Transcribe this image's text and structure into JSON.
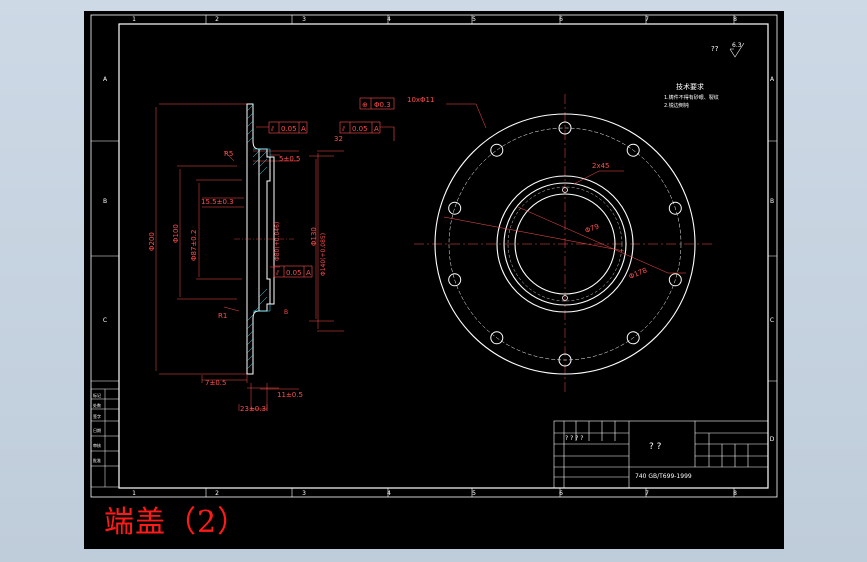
{
  "caption": "端盖（2）",
  "frame": {
    "columns": [
      "1",
      "2",
      "3",
      "4",
      "5",
      "6",
      "7",
      "8"
    ],
    "rows": [
      "A",
      "B",
      "C",
      "D"
    ]
  },
  "surface_symbol": {
    "qmarks": "??",
    "value": "6.3"
  },
  "tech_requirements": {
    "title": "技术要求",
    "lines": [
      "1.铸件不得有砂眼、裂纹",
      "2.锐边倒钝"
    ]
  },
  "side_view": {
    "dim_phi200": "Φ200",
    "dim_phi100": "Φ100",
    "dim_phi87": "Φ87±0.2",
    "dim_15_5": "15.5±0.3",
    "dim_5": "5±0.5",
    "dim_7": "7±0.5",
    "dim_11": "11±0.5",
    "dim_23": "23±0.3",
    "dim_phi130": "Φ130",
    "dim_phi140": "Φ140(+0.085)",
    "dim_phi80": "Φ80(+0.046)",
    "dim_32": "32",
    "r5": "R5",
    "r1": "R1",
    "tol_1": "0.05",
    "tol_2": "0.05",
    "tol_3": "0.05",
    "datum": "A",
    "b_label": "B"
  },
  "front_view": {
    "pos_tol": "Φ0.3",
    "pos_label": "10xΦ11",
    "dim_2x45": "2x45",
    "dim_phi79": "Φ79",
    "dim_phi178": "Φ178"
  },
  "title_block": {
    "part_name": "? ?",
    "material": "740 GB/T699-1999",
    "left_header": "? ? ? ?"
  },
  "left_table_labels": [
    "标记",
    "处数",
    "签字",
    "日期",
    "审核",
    "批准"
  ]
}
